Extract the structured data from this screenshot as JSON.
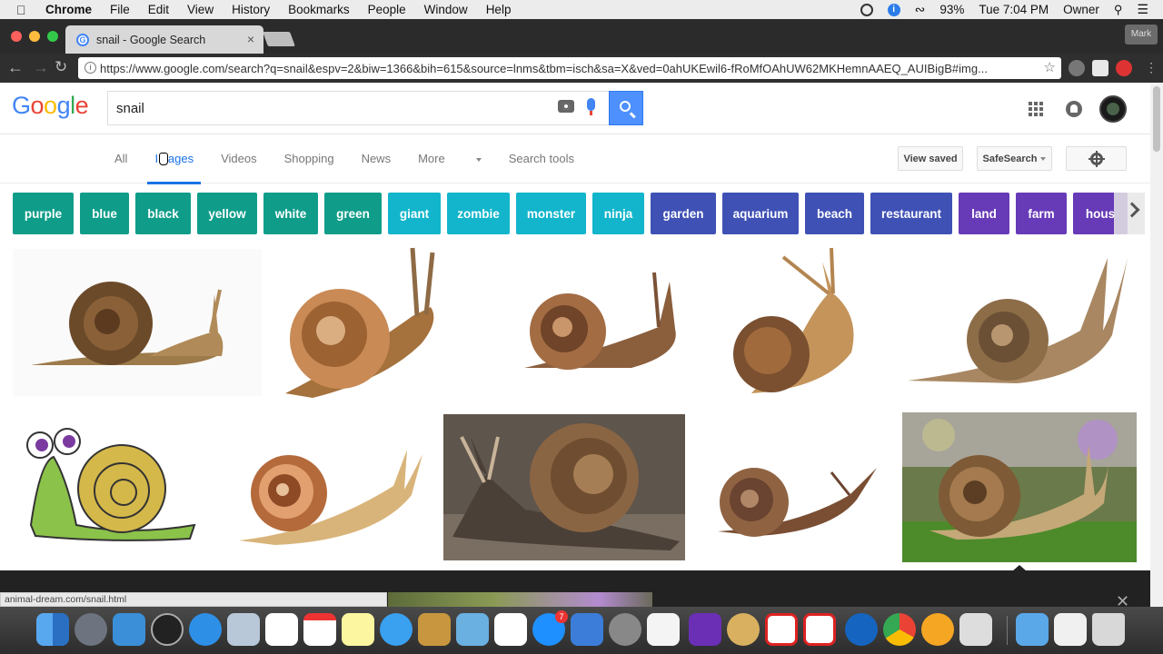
{
  "menubar": {
    "app": "Chrome",
    "items": [
      "File",
      "Edit",
      "View",
      "History",
      "Bookmarks",
      "People",
      "Window",
      "Help"
    ],
    "battery": "93%",
    "clock": "Tue 7:04 PM",
    "user": "Owner"
  },
  "browser": {
    "tab_title": "snail - Google Search",
    "profile_label": "Mark",
    "url": "https://www.google.com/search?q=snail&espv=2&biw=1366&bih=615&source=lnms&tbm=isch&sa=X&ved=0ahUKEwil6-fRoMfOAhUW62MKHemnAAEQ_AUIBigB#img..."
  },
  "google": {
    "logo": "Google",
    "query": "snail",
    "tabs": [
      "All",
      "Images",
      "Videos",
      "Shopping",
      "News",
      "More",
      "Search tools"
    ],
    "selected_tab": "Images",
    "view_saved": "View saved",
    "safesearch": "SafeSearch"
  },
  "chips": [
    {
      "label": "purple",
      "color": "#0f9d8a"
    },
    {
      "label": "blue",
      "color": "#0f9d8a"
    },
    {
      "label": "black",
      "color": "#0f9d8a"
    },
    {
      "label": "yellow",
      "color": "#0f9d8a"
    },
    {
      "label": "white",
      "color": "#0f9d8a"
    },
    {
      "label": "green",
      "color": "#0f9d8a"
    },
    {
      "label": "giant",
      "color": "#12b5cb"
    },
    {
      "label": "zombie",
      "color": "#12b5cb"
    },
    {
      "label": "monster",
      "color": "#12b5cb"
    },
    {
      "label": "ninja",
      "color": "#12b5cb"
    },
    {
      "label": "garden",
      "color": "#3f51b5"
    },
    {
      "label": "aquarium",
      "color": "#3f51b5"
    },
    {
      "label": "beach",
      "color": "#3f51b5"
    },
    {
      "label": "restaurant",
      "color": "#3f51b5"
    },
    {
      "label": "land",
      "color": "#673ab7"
    },
    {
      "label": "farm",
      "color": "#673ab7"
    },
    {
      "label": "hous",
      "color": "#673ab7"
    }
  ],
  "status_url": "animal-dream.com/snail.html"
}
